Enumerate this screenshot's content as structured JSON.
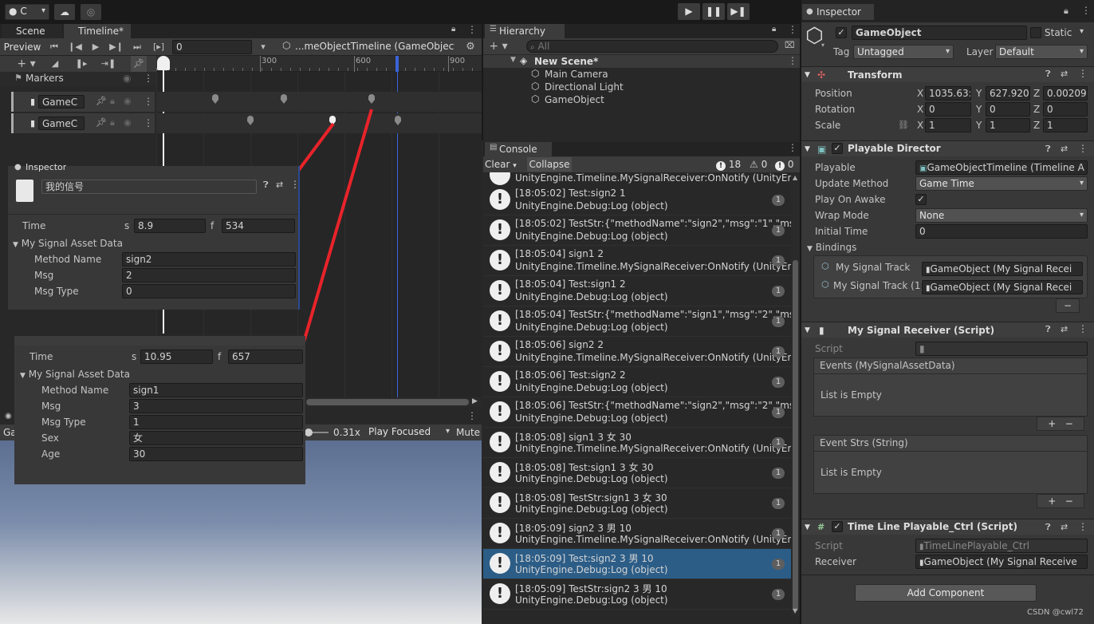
{
  "toolbar": {
    "account": "C",
    "cloud_icon": "cloud-icon",
    "collab_icon": "collab-icon"
  },
  "scene_tab": "Scene",
  "timeline": {
    "tab": "Timeline*",
    "preview": "Preview",
    "frame": "0",
    "asset": "...meObjectTimeline (GameObject)",
    "ruler": [
      "300",
      "600",
      "900"
    ],
    "markers_label": "Markers",
    "tracks": [
      {
        "name": "GameC"
      },
      {
        "name": "GameC"
      }
    ]
  },
  "signal_inspector": {
    "tab": "Inspector",
    "name": "我的信号",
    "time_label": "Time",
    "s_label": "s",
    "s_value": "8.9",
    "f_label": "f",
    "f_value": "534",
    "section": "My Signal Asset Data",
    "rows": [
      {
        "label": "Method Name",
        "value": "sign2"
      },
      {
        "label": "Msg",
        "value": "2"
      },
      {
        "label": "Msg Type",
        "value": "0"
      }
    ]
  },
  "signal_inspector2": {
    "time_label": "Time",
    "s_label": "s",
    "s_value": "10.95",
    "f_label": "f",
    "f_value": "657",
    "section": "My Signal Asset Data",
    "rows": [
      {
        "label": "Method Name",
        "value": "sign1"
      },
      {
        "label": "Msg",
        "value": "3"
      },
      {
        "label": "Msg Type",
        "value": "1"
      },
      {
        "label": "Sex",
        "value": "女"
      },
      {
        "label": "Age",
        "value": "30"
      }
    ]
  },
  "game_view": {
    "tab": "Ga",
    "scale": "0.31x",
    "play_mode": "Play Focused",
    "mute": "Mute"
  },
  "hierarchy": {
    "tab": "Hierarchy",
    "search_placeholder": "All",
    "scene": "New Scene*",
    "items": [
      "Main Camera",
      "Directional Light",
      "GameObject"
    ]
  },
  "console": {
    "tab": "Console",
    "clear": "Clear",
    "collapse": "Collapse",
    "log_count": "18",
    "warn_count": "0",
    "err_count": "0",
    "top_partial": "UnityEngine.Timeline.MySignalReceiver:OnNotify (UnityEngin",
    "logs": [
      {
        "l1": "[18:05:02] Test:sign2 1",
        "l2": "UnityEngine.Debug:Log (object)",
        "count": "1"
      },
      {
        "l1": "[18:05:02] TestStr:{\"methodName\":\"sign2\",\"msg\":\"1\",\"msgTyp",
        "l2": "UnityEngine.Debug:Log (object)",
        "count": "1"
      },
      {
        "l1": "[18:05:04] sign1 2",
        "l2": "UnityEngine.Timeline.MySignalReceiver:OnNotify (UnityEngin",
        "count": "1"
      },
      {
        "l1": "[18:05:04] Test:sign1 2",
        "l2": "UnityEngine.Debug:Log (object)",
        "count": "1"
      },
      {
        "l1": "[18:05:04] TestStr:{\"methodName\":\"sign1\",\"msg\":\"2\",\"msgTyp",
        "l2": "UnityEngine.Debug:Log (object)",
        "count": "1"
      },
      {
        "l1": "[18:05:06] sign2 2",
        "l2": "UnityEngine.Timeline.MySignalReceiver:OnNotify (UnityEngin",
        "count": "1"
      },
      {
        "l1": "[18:05:06] Test:sign2 2",
        "l2": "UnityEngine.Debug:Log (object)",
        "count": "1"
      },
      {
        "l1": "[18:05:06] TestStr:{\"methodName\":\"sign2\",\"msg\":\"2\",\"msgTyp",
        "l2": "UnityEngine.Debug:Log (object)",
        "count": "1"
      },
      {
        "l1": "[18:05:08] sign1 3 女 30",
        "l2": "UnityEngine.Timeline.MySignalReceiver:OnNotify (UnityEngin",
        "count": "1"
      },
      {
        "l1": "[18:05:08] Test:sign1 3 女 30",
        "l2": "UnityEngine.Debug:Log (object)",
        "count": "1"
      },
      {
        "l1": "[18:05:08] TestStr:sign1 3 女 30",
        "l2": "UnityEngine.Debug:Log (object)",
        "count": "1"
      },
      {
        "l1": "[18:05:09] sign2 3 男 10",
        "l2": "UnityEngine.Timeline.MySignalReceiver:OnNotify (UnityEngin",
        "count": "1"
      },
      {
        "l1": "[18:05:09] Test:sign2 3 男 10",
        "l2": "UnityEngine.Debug:Log (object)",
        "count": "1",
        "selected": true
      },
      {
        "l1": "[18:05:09] TestStr:sign2 3 男 10",
        "l2": "UnityEngine.Debug:Log (object)",
        "count": "1"
      }
    ]
  },
  "inspector": {
    "tab": "Inspector",
    "object_name": "GameObject",
    "static_label": "Static",
    "tag_label": "Tag",
    "tag_value": "Untagged",
    "layer_label": "Layer",
    "layer_value": "Default",
    "transform": {
      "title": "Transform",
      "rows": [
        {
          "label": "Position",
          "x": "1035.63:",
          "y": "627.9209",
          "z": "0.00209"
        },
        {
          "label": "Rotation",
          "x": "0",
          "y": "0",
          "z": "0"
        },
        {
          "label": "Scale",
          "x": "1",
          "y": "1",
          "z": "1"
        }
      ]
    },
    "director": {
      "title": "Playable Director",
      "playable_label": "Playable",
      "playable_value": "GameObjectTimeline (Timeline A",
      "update_label": "Update Method",
      "update_value": "Game Time",
      "awake_label": "Play On Awake",
      "wrap_label": "Wrap Mode",
      "wrap_value": "None",
      "initial_label": "Initial Time",
      "initial_value": "0",
      "bindings_label": "Bindings",
      "bindings": [
        {
          "track": "My Signal Track",
          "obj": "GameObject (My Signal Recei"
        },
        {
          "track": "My Signal Track (1)",
          "obj": "GameObject (My Signal Recei"
        }
      ]
    },
    "receiver": {
      "title": "My Signal Receiver (Script)",
      "script_label": "Script",
      "events_label": "Events (MySignalAssetData)",
      "events_empty": "List is Empty",
      "strs_label": "Event Strs (String)",
      "strs_empty": "List is Empty"
    },
    "ctrl": {
      "title": "Time Line Playable_Ctrl (Script)",
      "script_label": "Script",
      "script_value": "TimeLinePlayable_Ctrl",
      "receiver_label": "Receiver",
      "receiver_value": "GameObject (My Signal Receive"
    },
    "add_component": "Add Component"
  },
  "watermark": "CSDN @cwl72"
}
